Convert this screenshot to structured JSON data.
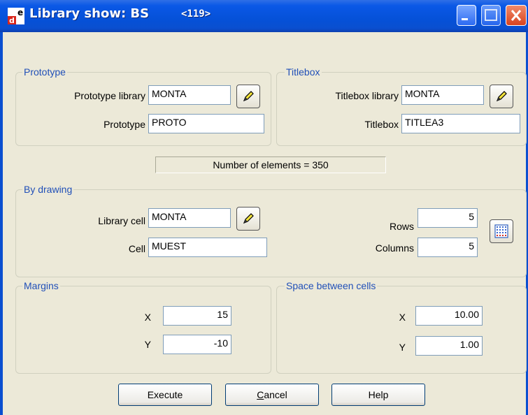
{
  "window": {
    "title": "Library show: BS",
    "code": "<119>",
    "accent": "#0a4fd0",
    "icons": [
      "app-e-d-icon",
      "minimize-icon",
      "maximize-icon",
      "close-icon"
    ]
  },
  "prototype": {
    "group_label": "Prototype",
    "library_label": "Prototype library",
    "library_value": "MONTA",
    "prototype_label": "Prototype",
    "prototype_value": "PROTO"
  },
  "titlebox": {
    "group_label": "Titlebox",
    "library_label": "Titlebox library",
    "library_value": "MONTA",
    "titlebox_label": "Titlebox",
    "titlebox_value": "TITLEA3"
  },
  "count_text": "Number of elements = 350",
  "by_drawing": {
    "group_label": "By drawing",
    "library_cell_label": "Library cell",
    "library_cell_value": "MONTA",
    "cell_label": "Cell",
    "cell_value": "MUEST",
    "rows_label": "Rows",
    "rows_value": "5",
    "columns_label": "Columns",
    "columns_value": "5"
  },
  "margins": {
    "group_label": "Margins",
    "x_label": "X",
    "x_value": "15",
    "y_label": "Y",
    "y_value": "-10"
  },
  "space": {
    "group_label": "Space between cells",
    "x_label": "X",
    "x_value": "10.00",
    "y_label": "Y",
    "y_value": "1.00"
  },
  "buttons": {
    "execute": "Execute",
    "cancel_prefix": "C",
    "cancel_rest": "ancel",
    "help": "Help"
  }
}
